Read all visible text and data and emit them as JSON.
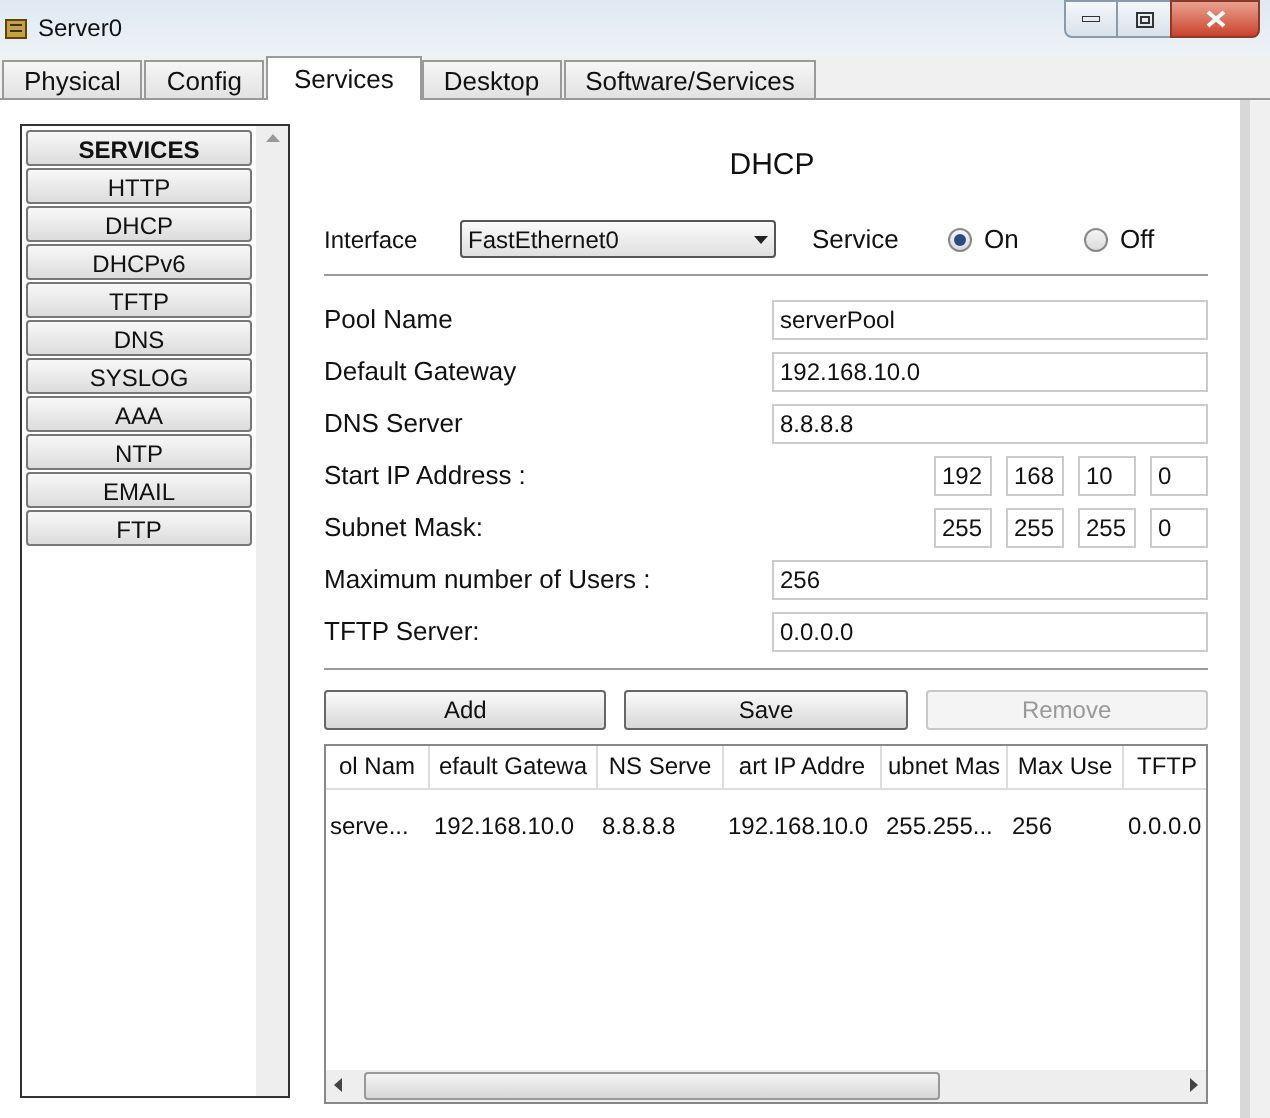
{
  "window": {
    "title": "Server0"
  },
  "tabs": [
    {
      "label": "Physical",
      "selected": false
    },
    {
      "label": "Config",
      "selected": false
    },
    {
      "label": "Services",
      "selected": true
    },
    {
      "label": "Desktop",
      "selected": false
    },
    {
      "label": "Software/Services",
      "selected": false
    }
  ],
  "services": {
    "header": "SERVICES",
    "items": [
      {
        "label": "HTTP"
      },
      {
        "label": "DHCP"
      },
      {
        "label": "DHCPv6"
      },
      {
        "label": "TFTP"
      },
      {
        "label": "DNS"
      },
      {
        "label": "SYSLOG"
      },
      {
        "label": "AAA"
      },
      {
        "label": "NTP"
      },
      {
        "label": "EMAIL"
      },
      {
        "label": "FTP"
      }
    ]
  },
  "dhcp": {
    "title": "DHCP",
    "interface_label": "Interface",
    "interface_value": "FastEthernet0",
    "service_label": "Service",
    "service_options": [
      {
        "label": "On",
        "selected": true
      },
      {
        "label": "Off",
        "selected": false
      }
    ],
    "fields": [
      {
        "kind": "text",
        "label": "Pool Name",
        "value": "serverPool"
      },
      {
        "kind": "text",
        "label": "Default Gateway",
        "value": "192.168.10.0"
      },
      {
        "kind": "text",
        "label": "DNS Server",
        "value": "8.8.8.8"
      },
      {
        "kind": "ip",
        "label": "Start IP Address :",
        "octets": [
          "192",
          "168",
          "10",
          "0"
        ]
      },
      {
        "kind": "ip",
        "label": "Subnet Mask:",
        "octets": [
          "255",
          "255",
          "255",
          "0"
        ]
      },
      {
        "kind": "text",
        "label": "Maximum number of Users :",
        "value": "256"
      },
      {
        "kind": "text",
        "label": "TFTP Server:",
        "value": "0.0.0.0"
      }
    ],
    "buttons": [
      {
        "label": "Add",
        "disabled": false
      },
      {
        "label": "Save",
        "disabled": false
      },
      {
        "label": "Remove",
        "disabled": true
      }
    ],
    "table": {
      "columns": [
        "ol Nam",
        "efault Gatewa",
        "NS Serve",
        "art IP Addre",
        "ubnet Mas",
        "Max Use",
        "TFTP"
      ],
      "rows": [
        [
          "serve...",
          "192.168.10.0",
          "8.8.8.8",
          "192.168.10.0",
          "255.255...",
          "256",
          "0.0.0.0"
        ]
      ]
    }
  }
}
